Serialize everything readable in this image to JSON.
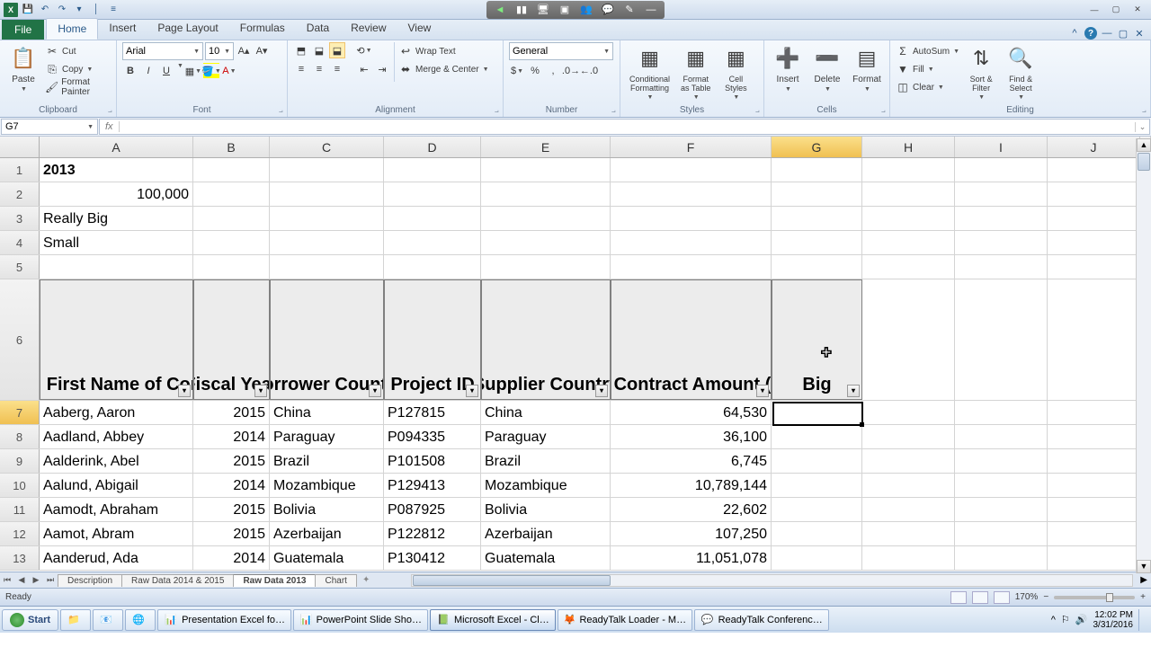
{
  "qat": {
    "save": "💾",
    "undo": "↶",
    "redo": "↷"
  },
  "window": {
    "min": "—",
    "max": "▢",
    "close": "✕"
  },
  "ribbon": {
    "fileTab": "File",
    "tabs": [
      "Home",
      "Insert",
      "Page Layout",
      "Formulas",
      "Data",
      "Review",
      "View"
    ],
    "activeTab": "Home",
    "clipboard": {
      "paste": "Paste",
      "cut": "Cut",
      "copy": "Copy",
      "formatPainter": "Format Painter",
      "label": "Clipboard"
    },
    "font": {
      "name": "Arial",
      "size": "10",
      "bold": "B",
      "italic": "I",
      "underline": "U",
      "label": "Font"
    },
    "alignment": {
      "wrap": "Wrap Text",
      "merge": "Merge & Center",
      "label": "Alignment"
    },
    "number": {
      "format": "General",
      "label": "Number"
    },
    "styles": {
      "conditional": "Conditional\nFormatting",
      "table": "Format\nas Table",
      "cell": "Cell\nStyles",
      "label": "Styles"
    },
    "cells": {
      "insert": "Insert",
      "delete": "Delete",
      "format": "Format",
      "label": "Cells"
    },
    "editing": {
      "autosum": "AutoSum",
      "fill": "Fill",
      "clear": "Clear",
      "sort": "Sort &\nFilter",
      "find": "Find &\nSelect",
      "label": "Editing"
    }
  },
  "nameBox": "G7",
  "columns": [
    "A",
    "B",
    "C",
    "D",
    "E",
    "F",
    "G",
    "H",
    "I",
    "J"
  ],
  "rows": [
    {
      "n": "1",
      "A": "2013",
      "boldA": true
    },
    {
      "n": "2",
      "A": "100,000",
      "rightA": true
    },
    {
      "n": "3",
      "A": "Really Big"
    },
    {
      "n": "4",
      "A": "Small"
    },
    {
      "n": "5"
    }
  ],
  "headers": {
    "A": "Last, First Name of Contact",
    "B": "Fiscal Year",
    "C": "Borrower Country",
    "D": "Project ID",
    "E": "Supplier Country",
    "F": "Total Contract Amount (USD)",
    "G": "Big",
    "rowNum": "6"
  },
  "data": [
    {
      "n": "7",
      "A": "Aaberg, Aaron",
      "B": "2015",
      "C": "China",
      "D": "P127815",
      "E": "China",
      "F": "64,530"
    },
    {
      "n": "8",
      "A": "Aadland, Abbey",
      "B": "2014",
      "C": "Paraguay",
      "D": "P094335",
      "E": "Paraguay",
      "F": "36,100"
    },
    {
      "n": "9",
      "A": "Aalderink, Abel",
      "B": "2015",
      "C": "Brazil",
      "D": "P101508",
      "E": "Brazil",
      "F": "6,745"
    },
    {
      "n": "10",
      "A": "Aalund, Abigail",
      "B": "2014",
      "C": "Mozambique",
      "D": "P129413",
      "E": "Mozambique",
      "F": "10,789,144"
    },
    {
      "n": "11",
      "A": "Aamodt, Abraham",
      "B": "2015",
      "C": "Bolivia",
      "D": "P087925",
      "E": "Bolivia",
      "F": "22,602"
    },
    {
      "n": "12",
      "A": "Aamot, Abram",
      "B": "2015",
      "C": "Azerbaijan",
      "D": "P122812",
      "E": "Azerbaijan",
      "F": "107,250"
    },
    {
      "n": "13",
      "A": "Aanderud, Ada",
      "B": "2014",
      "C": "Guatemala",
      "D": "P130412",
      "E": "Guatemala",
      "F": "11,051,078"
    }
  ],
  "sheetTabs": [
    "Description",
    "Raw Data 2014 & 2015",
    "Raw Data 2013",
    "Chart"
  ],
  "activeSheet": "Raw Data 2013",
  "status": {
    "ready": "Ready",
    "zoom": "170%"
  },
  "taskbar": {
    "start": "Start",
    "items": [
      {
        "icon": "📁",
        "label": ""
      },
      {
        "icon": "📧",
        "label": ""
      },
      {
        "icon": "🌐",
        "label": ""
      },
      {
        "icon": "📊",
        "label": "Presentation Excel fo…"
      },
      {
        "icon": "📊",
        "label": "PowerPoint Slide Sho…"
      },
      {
        "icon": "📗",
        "label": "Microsoft Excel - Cl…",
        "active": true
      },
      {
        "icon": "🦊",
        "label": "ReadyTalk Loader - M…"
      },
      {
        "icon": "💬",
        "label": "ReadyTalk Conferenc…"
      }
    ],
    "time": "12:02 PM",
    "date": "3/31/2016"
  }
}
